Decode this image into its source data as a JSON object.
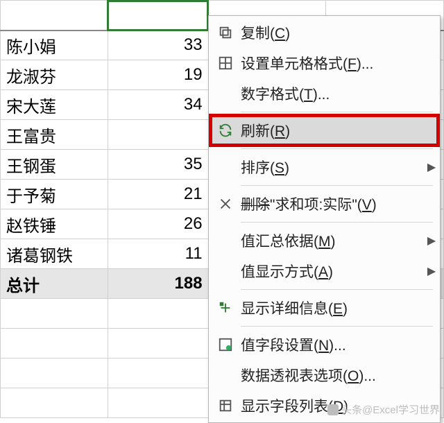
{
  "rows": [
    {
      "name": "陈小娟",
      "val": "33"
    },
    {
      "name": "龙淑芬",
      "val": "19"
    },
    {
      "name": "宋大莲",
      "val": "34"
    },
    {
      "name": "王富贵",
      "val": ""
    },
    {
      "name": "王钢蛋",
      "val": "35"
    },
    {
      "name": "于予菊",
      "val": "21"
    },
    {
      "name": "赵铁锤",
      "val": "26"
    },
    {
      "name": "诸葛钢铁",
      "val": "11"
    }
  ],
  "total": {
    "label": "总计",
    "val": "188"
  },
  "menu": {
    "copy": {
      "t": "复制",
      "k": "C"
    },
    "fmtcell": {
      "t": "设置单元格格式",
      "k": "F",
      "dots": "..."
    },
    "numfmt": {
      "t": "数字格式",
      "k": "T",
      "dots": "..."
    },
    "refresh": {
      "t": "刷新",
      "k": "R"
    },
    "sort": {
      "t": "排序",
      "k": "S"
    },
    "del": {
      "pre": "删除",
      "q1": "\"",
      "mid": "求和项:实际",
      "q2": "\"",
      "k": "V"
    },
    "sumby": {
      "t": "值汇总依据",
      "k": "M"
    },
    "showas": {
      "t": "值显示方式",
      "k": "A"
    },
    "detail": {
      "t": "显示详细信息",
      "k": "E"
    },
    "vfs": {
      "t": "值字段设置",
      "k": "N",
      "dots": "..."
    },
    "ptopt": {
      "t": "数据透视表选项",
      "k": "O",
      "dots": "..."
    },
    "flist": {
      "t": "显示字段列表",
      "k": "D"
    }
  },
  "watermark": "头条@Excel学习世界"
}
